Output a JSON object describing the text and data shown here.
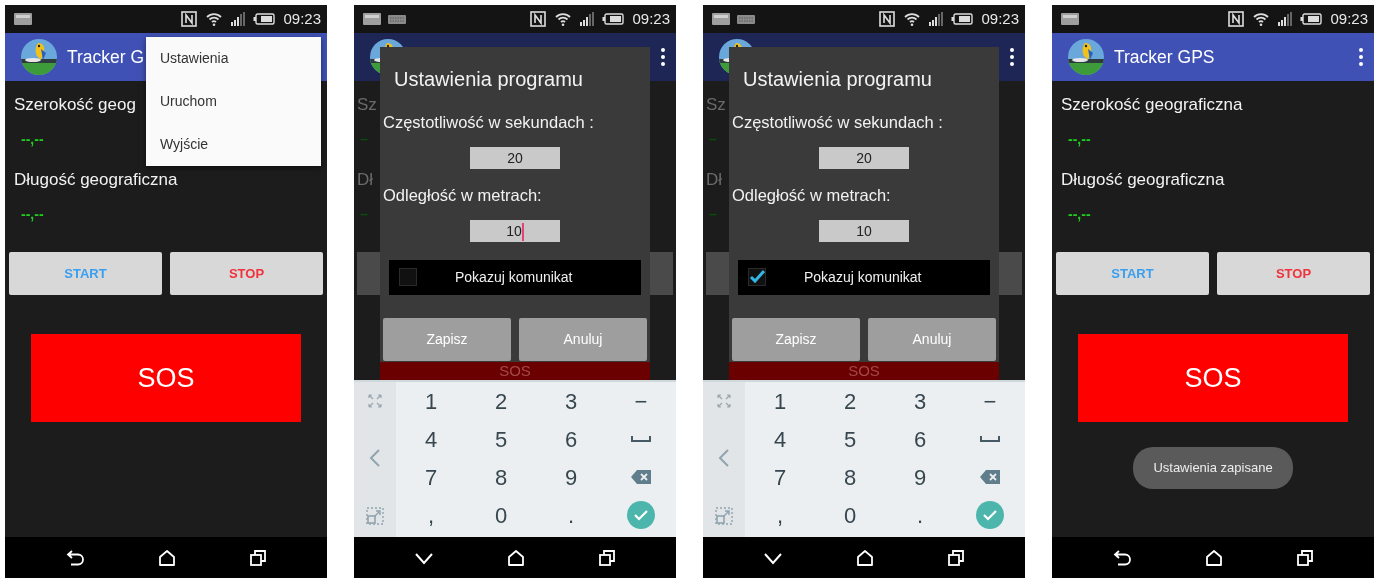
{
  "phones": [
    {
      "status_bar": {
        "time": "09:23",
        "keyboard_icon": false
      },
      "app_bar": {
        "title": "Tracker G",
        "dimmed": false
      },
      "fields": [
        {
          "label": "Szerokość geog",
          "value": "--,--"
        },
        {
          "label": "Długość geograficzna",
          "value": "--,--"
        }
      ],
      "buttons": [
        {
          "label": "START",
          "color": "#3a9ff0"
        },
        {
          "label": "STOP",
          "color": "#f0323c"
        }
      ],
      "sos": "SOS",
      "menu": {
        "items": [
          "Ustawienia",
          "Uruchom",
          "Wyjście"
        ]
      },
      "nav_bar": {
        "keys": [
          {
            "kind": "back"
          },
          {
            "kind": "home"
          },
          {
            "kind": "recents"
          }
        ]
      }
    },
    {
      "status_bar": {
        "time": "09:23",
        "keyboard_icon": true
      },
      "app_bar": {
        "dimmed": true,
        "overflow_button": true
      },
      "fields": [
        {
          "label": "Sz",
          "value": "–"
        },
        {
          "label": "Dł",
          "value": "–"
        }
      ],
      "sos": "SOS",
      "dialog": {
        "title": "Ustawienia programu",
        "fields": [
          {
            "label": "Częstotliwość w sekundach :",
            "value": "20",
            "focused": false
          },
          {
            "label": "Odległość w metrach:",
            "value": "10",
            "focused": true
          }
        ],
        "checkbox": {
          "label": "Pokazuj komunikat",
          "checked": false
        },
        "buttons": [
          "Zapisz",
          "Anuluj"
        ]
      },
      "keyboard": {
        "rows": [
          {
            "keys": [
              {
                "kind": "char",
                "label": "1"
              },
              {
                "kind": "char",
                "label": "2"
              },
              {
                "kind": "char",
                "label": "3"
              },
              {
                "kind": "char",
                "label": "−"
              }
            ]
          },
          {
            "keys": [
              {
                "kind": "char",
                "label": "4"
              },
              {
                "kind": "char",
                "label": "5"
              },
              {
                "kind": "char",
                "label": "6"
              },
              {
                "kind": "space"
              }
            ]
          },
          {
            "keys": [
              {
                "kind": "char",
                "label": "7"
              },
              {
                "kind": "char",
                "label": "8"
              },
              {
                "kind": "char",
                "label": "9"
              },
              {
                "kind": "backspace"
              }
            ]
          },
          {
            "keys": [
              {
                "kind": "char",
                "label": ","
              },
              {
                "kind": "char",
                "label": "0"
              },
              {
                "kind": "char",
                "label": "."
              },
              {
                "kind": "done"
              }
            ]
          }
        ]
      },
      "nav_bar": {
        "keys": [
          {
            "kind": "hide"
          },
          {
            "kind": "home"
          },
          {
            "kind": "recents"
          }
        ]
      }
    },
    {
      "status_bar": {
        "time": "09:23",
        "keyboard_icon": true
      },
      "app_bar": {
        "dimmed": true,
        "overflow_button": true
      },
      "fields": [
        {
          "label": "Sz",
          "value": "–"
        },
        {
          "label": "Dł",
          "value": "–"
        }
      ],
      "sos": "SOS",
      "dialog": {
        "title": "Ustawienia programu",
        "fields": [
          {
            "label": "Częstotliwość w sekundach :",
            "value": "20",
            "focused": false
          },
          {
            "label": "Odległość w metrach:",
            "value": "10",
            "focused": false
          }
        ],
        "checkbox": {
          "label": "Pokazuj komunikat",
          "checked": true
        },
        "buttons": [
          "Zapisz",
          "Anuluj"
        ]
      },
      "keyboard": {
        "rows": [
          {
            "keys": [
              {
                "kind": "char",
                "label": "1"
              },
              {
                "kind": "char",
                "label": "2"
              },
              {
                "kind": "char",
                "label": "3"
              },
              {
                "kind": "char",
                "label": "−"
              }
            ]
          },
          {
            "keys": [
              {
                "kind": "char",
                "label": "4"
              },
              {
                "kind": "char",
                "label": "5"
              },
              {
                "kind": "char",
                "label": "6"
              },
              {
                "kind": "space"
              }
            ]
          },
          {
            "keys": [
              {
                "kind": "char",
                "label": "7"
              },
              {
                "kind": "char",
                "label": "8"
              },
              {
                "kind": "char",
                "label": "9"
              },
              {
                "kind": "backspace"
              }
            ]
          },
          {
            "keys": [
              {
                "kind": "char",
                "label": ","
              },
              {
                "kind": "char",
                "label": "0"
              },
              {
                "kind": "char",
                "label": "."
              },
              {
                "kind": "done"
              }
            ]
          }
        ]
      },
      "nav_bar": {
        "keys": [
          {
            "kind": "hide"
          },
          {
            "kind": "home"
          },
          {
            "kind": "recents"
          }
        ]
      }
    },
    {
      "status_bar": {
        "time": "09:23",
        "keyboard_icon": false
      },
      "app_bar": {
        "title": "Tracker GPS",
        "dimmed": false,
        "overflow_button": true
      },
      "fields": [
        {
          "label": "Szerokość geograficzna",
          "value": "--,--"
        },
        {
          "label": "Długość geograficzna",
          "value": "--,--"
        }
      ],
      "buttons": [
        {
          "label": "START",
          "color": "#3a9ff0"
        },
        {
          "label": "STOP",
          "color": "#f0323c"
        }
      ],
      "sos": "SOS",
      "toast": "Ustawienia zapisane",
      "nav_bar": {
        "keys": [
          {
            "kind": "back"
          },
          {
            "kind": "home"
          },
          {
            "kind": "recents"
          }
        ]
      }
    }
  ]
}
